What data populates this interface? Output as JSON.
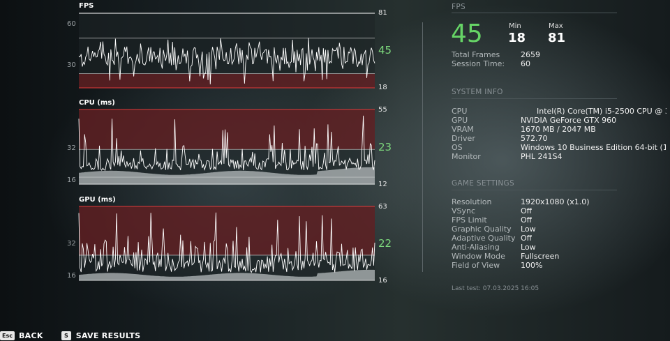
{
  "charts": {
    "fps": {
      "title": "FPS",
      "max_label": "81",
      "min_label": "18",
      "current": "45",
      "tick_top": "60",
      "tick_mid": "30"
    },
    "cpu": {
      "title": "CPU (ms)",
      "max_label": "55",
      "min_label": "12",
      "current": "23",
      "tick_mid": "32",
      "tick_low": "16"
    },
    "gpu": {
      "title": "GPU (ms)",
      "max_label": "63",
      "min_label": "16",
      "current": "22",
      "tick_mid": "32",
      "tick_low": "16"
    }
  },
  "chart_data": [
    {
      "type": "line",
      "title": "FPS",
      "ylim": [
        18,
        81
      ],
      "current": 45,
      "min": 18,
      "max": 81,
      "y_ticks": [
        30,
        60
      ]
    },
    {
      "type": "line",
      "title": "CPU (ms)",
      "ylim": [
        12,
        55
      ],
      "current": 23,
      "min": 12,
      "max": 55,
      "y_ticks": [
        16,
        32
      ]
    },
    {
      "type": "line",
      "title": "GPU (ms)",
      "ylim": [
        16,
        63
      ],
      "current": 22,
      "min": 16,
      "max": 63,
      "y_ticks": [
        16,
        32
      ]
    }
  ],
  "fps_panel": {
    "section_title": "FPS",
    "current": "45",
    "min_label": "Min",
    "min_value": "18",
    "max_label": "Max",
    "max_value": "81",
    "total_frames_label": "Total Frames",
    "total_frames_value": "2659",
    "session_time_label": "Session Time:",
    "session_time_value": "60"
  },
  "system_info": {
    "section_title": "SYSTEM INFO",
    "rows": [
      {
        "label": "CPU",
        "value": "Intel(R) Core(TM) i5-2500 CPU @ 3..."
      },
      {
        "label": "GPU",
        "value": "NVIDIA GeForce GTX 960"
      },
      {
        "label": "VRAM",
        "value": "1670 MB / 2047 MB"
      },
      {
        "label": "Driver",
        "value": "572.70"
      },
      {
        "label": "OS",
        "value": "Windows 10 Business Edition 64-bit (1..."
      },
      {
        "label": "Monitor",
        "value": "PHL 241S4"
      }
    ]
  },
  "game_settings": {
    "section_title": "GAME SETTINGS",
    "rows": [
      {
        "label": "Resolution",
        "value": "1920x1080 (x1.0)"
      },
      {
        "label": "VSync",
        "value": "Off"
      },
      {
        "label": "FPS Limit",
        "value": "Off"
      },
      {
        "label": "Graphic Quality",
        "value": "Low"
      },
      {
        "label": "Adaptive Quality",
        "value": "Off"
      },
      {
        "label": "Anti-Aliasing",
        "value": "Low"
      },
      {
        "label": "Window Mode",
        "value": "Fullscreen"
      },
      {
        "label": "Field of View",
        "value": "100%"
      }
    ],
    "last_test": "Last test: 07.03.2025 16:05"
  },
  "footer": {
    "back_key": "Esc",
    "back_label": "BACK",
    "save_key": "S",
    "save_label": "SAVE RESULTS"
  },
  "colors": {
    "accent_green": "#66d466",
    "danger_band": "#7a1e22",
    "limit_line": "#e03a3a",
    "graph_line": "#ffffff"
  }
}
